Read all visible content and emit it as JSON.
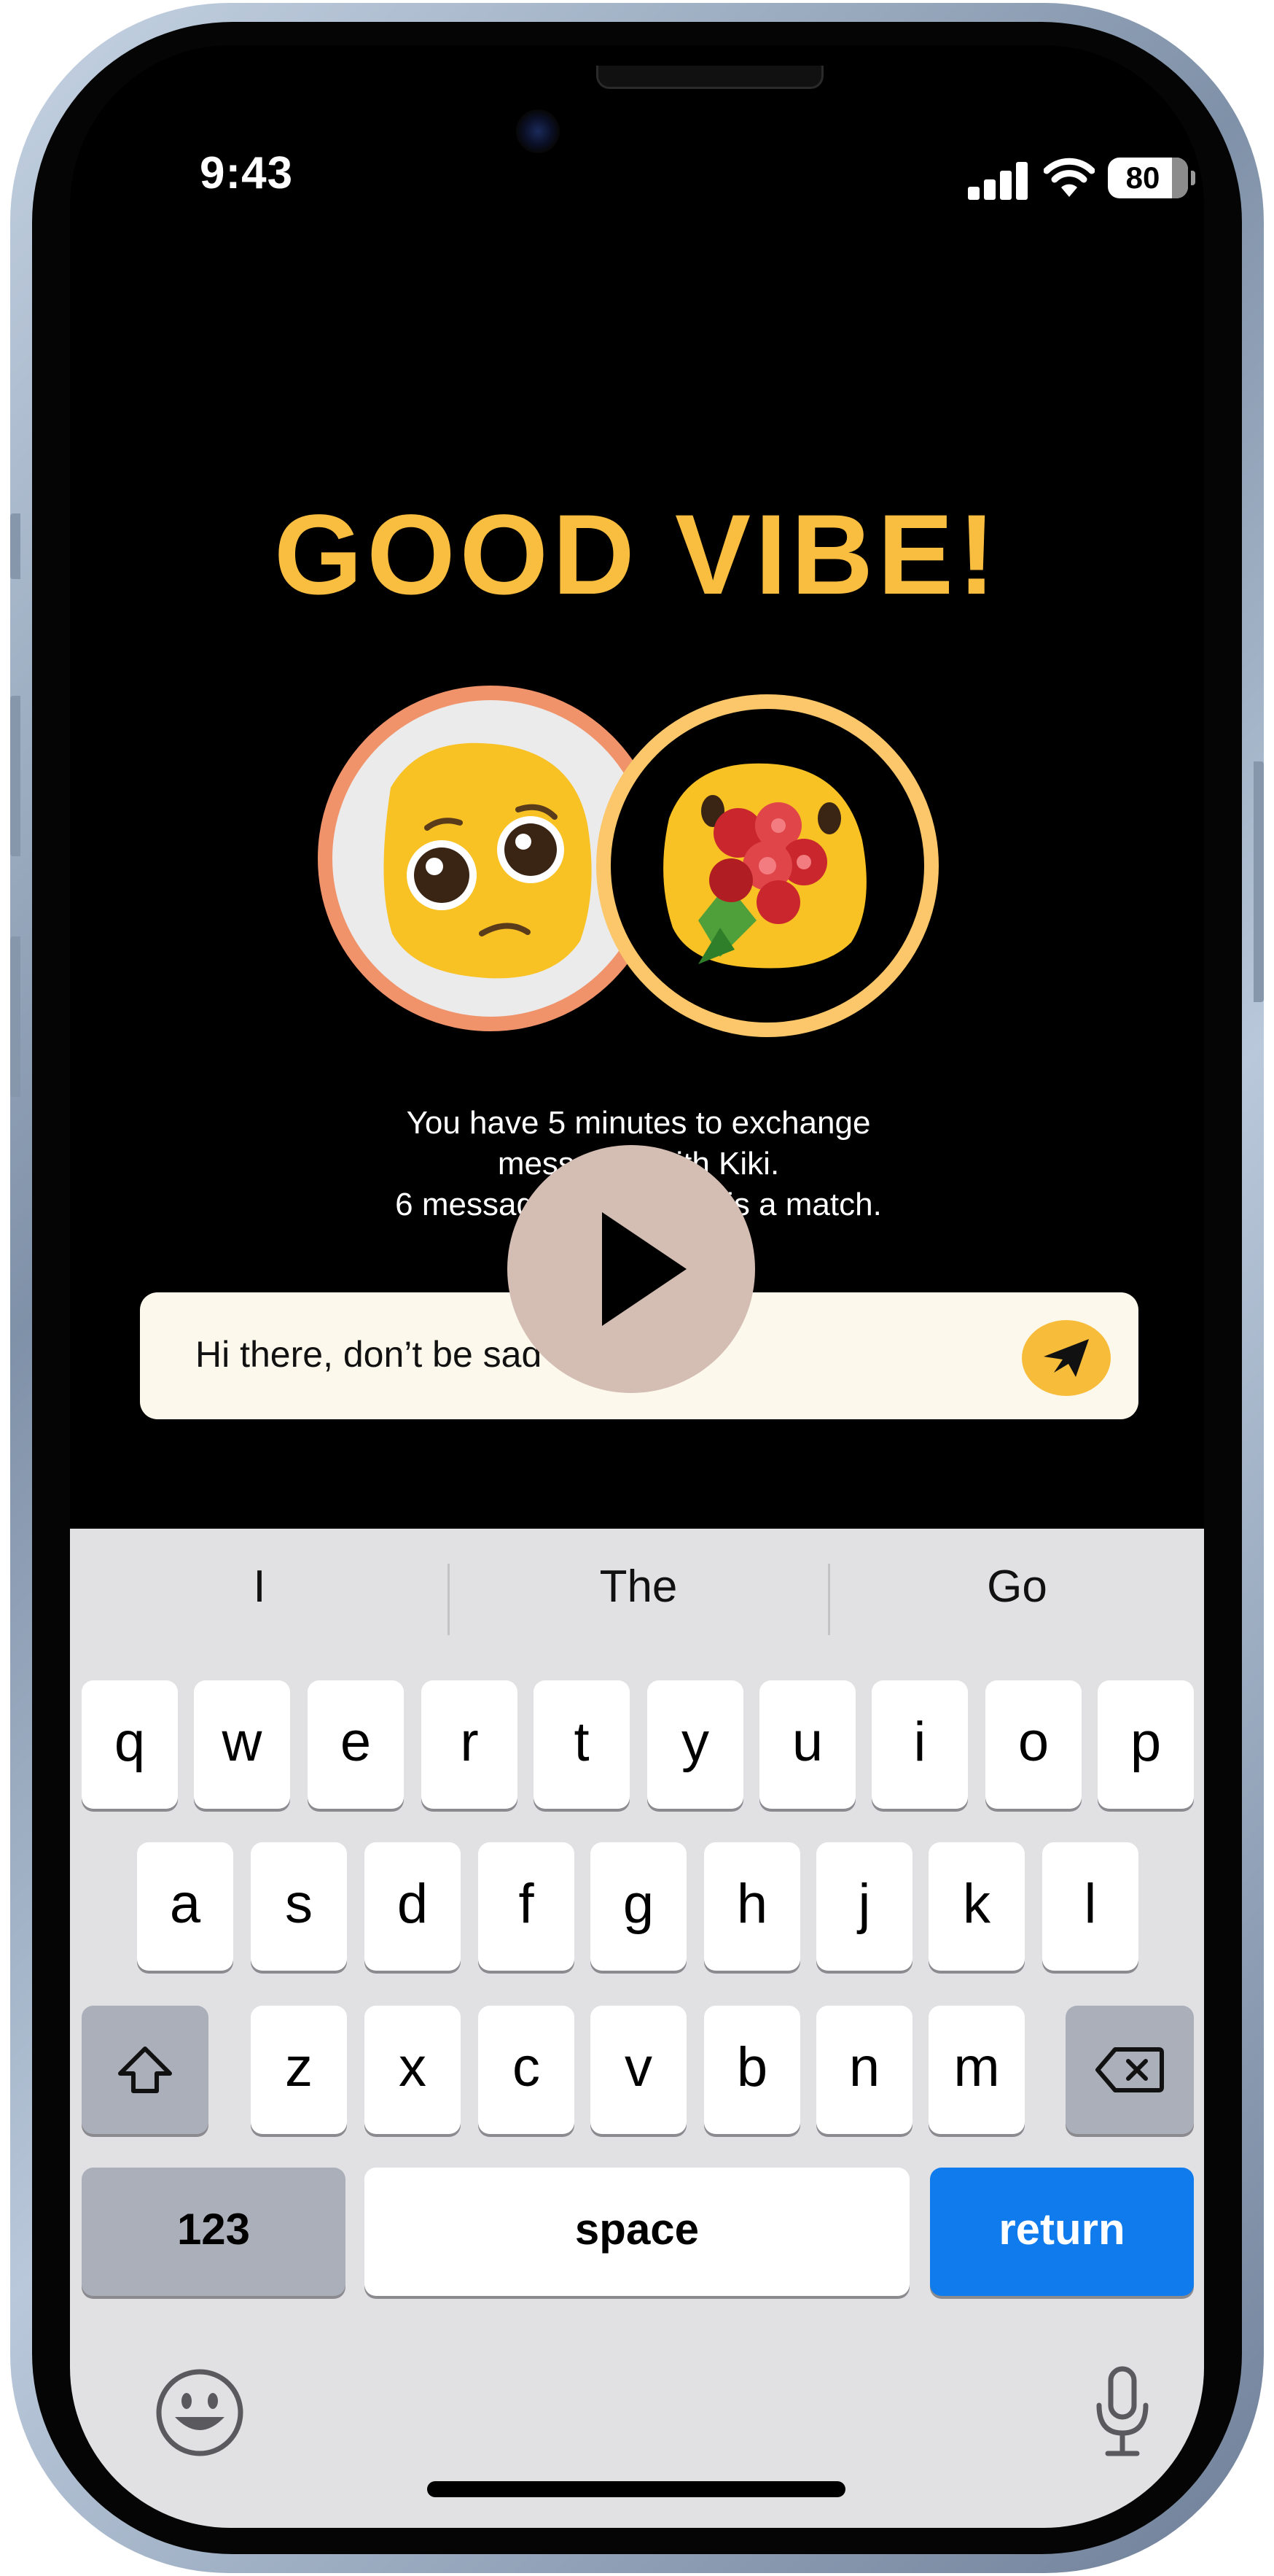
{
  "status_bar": {
    "time": "9:43",
    "battery": "80",
    "icons": [
      "signal-icon",
      "wifi-icon",
      "battery-icon"
    ]
  },
  "match": {
    "title": "GOOD VIBE!",
    "avatars": [
      "pleading-face-emoji",
      "face-with-bouquet-emoji"
    ],
    "info_lines": [
      "You have 5 minutes to exchange",
      "messages with Kiki.",
      "6 messages to make this a match."
    ]
  },
  "composer": {
    "message": "Hi there, don’t be sad",
    "send_icon": "send-icon"
  },
  "overlay": {
    "play_icon": "play-icon"
  },
  "keyboard": {
    "suggestions": [
      "I",
      "The",
      "Go"
    ],
    "row1": [
      "q",
      "w",
      "e",
      "r",
      "t",
      "y",
      "u",
      "i",
      "o",
      "p"
    ],
    "row2": [
      "a",
      "s",
      "d",
      "f",
      "g",
      "h",
      "j",
      "k",
      "l"
    ],
    "row3": [
      "z",
      "x",
      "c",
      "v",
      "b",
      "n",
      "m"
    ],
    "numbers_label": "123",
    "space_label": "space",
    "return_label": "return",
    "return_color": "#0f7bec",
    "icons": [
      "shift-icon",
      "delete-icon",
      "emoji-icon",
      "microphone-icon"
    ]
  }
}
